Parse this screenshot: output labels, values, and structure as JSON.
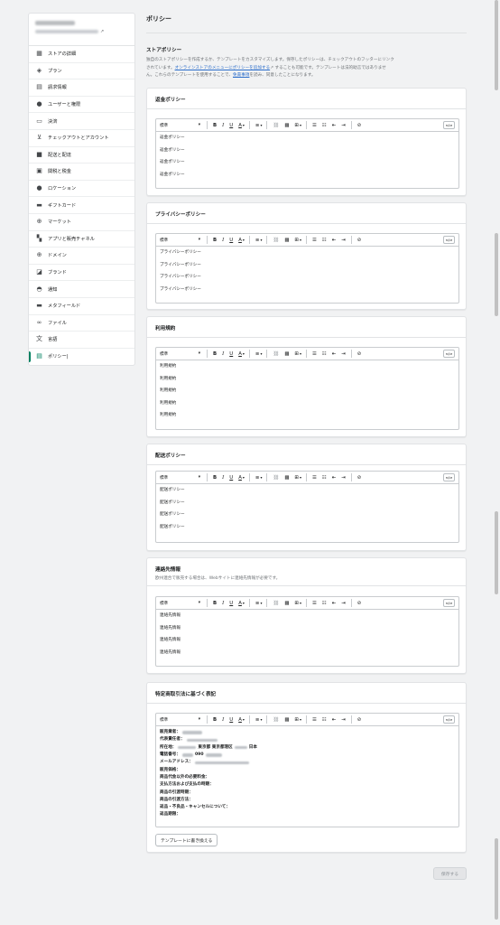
{
  "sidebar": {
    "items": [
      {
        "icon": "store-icon",
        "glyph": "▦",
        "label": "ストアの詳細"
      },
      {
        "icon": "plan-icon",
        "glyph": "◈",
        "label": "プラン"
      },
      {
        "icon": "billing-icon",
        "glyph": "▤",
        "label": "請求情報"
      },
      {
        "icon": "user-icon",
        "glyph": "●",
        "label": "ユーザーと権限"
      },
      {
        "icon": "payment-icon",
        "glyph": "▭",
        "label": "決済"
      },
      {
        "icon": "cart-icon",
        "glyph": "⊻",
        "label": "チェックアウトとアカウント"
      },
      {
        "icon": "truck-icon",
        "glyph": "■",
        "label": "配送と配達"
      },
      {
        "icon": "tax-icon",
        "glyph": "▣",
        "label": "関税と税金"
      },
      {
        "icon": "location-icon",
        "glyph": "●",
        "label": "ロケーション"
      },
      {
        "icon": "gift-card-icon",
        "glyph": "▬",
        "label": "ギフトカード"
      },
      {
        "icon": "globe-icon",
        "glyph": "⊕",
        "label": "マーケット"
      },
      {
        "icon": "apps-icon",
        "glyph": "▚",
        "label": "アプリと販売チャネル"
      },
      {
        "icon": "domain-icon",
        "glyph": "⊕",
        "label": "ドメイン"
      },
      {
        "icon": "brand-icon",
        "glyph": "◪",
        "label": "ブランド"
      },
      {
        "icon": "bell-icon",
        "glyph": "◓",
        "label": "通知"
      },
      {
        "icon": "metafield-icon",
        "glyph": "▬",
        "label": "メタフィールド"
      },
      {
        "icon": "file-icon",
        "glyph": "∞",
        "label": "ファイル"
      },
      {
        "icon": "language-icon",
        "glyph": "文",
        "label": "言語"
      },
      {
        "icon": "policy-icon",
        "glyph": "▤",
        "label": "ポリシー|",
        "active": true
      }
    ]
  },
  "page": {
    "title": "ポリシー"
  },
  "intro": {
    "title": "ストアポリシー",
    "text_1": "独自のストアポリシーを作成するか、テンプレートをカスタマイズします。保存したポリシーは、チェックアウトのフッターにリンク",
    "text_2a": "されています。",
    "link_1": "オンラインストアのメニューにポリシーを追加する",
    "ext_glyph": "↗",
    "text_2b": "することも可能です。テンプレートは法的助言ではありませ",
    "text_3a": "ん。これらのテンプレートを使用することで、",
    "link_2": "免責事項",
    "text_3b": "を読み、同意したことになります。"
  },
  "toolbar": {
    "format": "標準",
    "caret": "▾",
    "bold": "B",
    "italic": "I",
    "underline": "U",
    "color": "A",
    "align": "≡",
    "link": "⛓",
    "image": "▦",
    "table": "⊞",
    "bullet": "☰",
    "number": "☷",
    "outdent": "⇤",
    "indent": "⇥",
    "clear": "⊘",
    "html": "</>"
  },
  "cards": {
    "refund": {
      "title": "返金ポリシー",
      "lines": [
        "返金ポリシー",
        "返金ポリシー",
        "返金ポリシー",
        "返金ポリシー"
      ]
    },
    "privacy": {
      "title": "プライバシーポリシー",
      "lines": [
        "プライバシーポリシー",
        "プライバシーポリシー",
        "プライバシーポリシー",
        "プライバシーポリシー"
      ]
    },
    "terms": {
      "title": "利用規約",
      "lines": [
        "利用規約",
        "利用規約",
        "利用規約",
        "利用規約",
        "利用規約"
      ]
    },
    "shipping": {
      "title": "配送ポリシー",
      "lines": [
        "配送ポリシー",
        "配送ポリシー",
        "配送ポリシー",
        "配送ポリシー"
      ]
    },
    "contact": {
      "title": "連絡先情報",
      "description": "欧州連合で販売する場合は、Webサイトに連絡先情報が必要です。",
      "lines": [
        "連絡先情報",
        "連絡先情報",
        "連絡先情報",
        "連絡先情報"
      ]
    },
    "tokusho": {
      "title": "特定商取引法に基づく表記",
      "lines": [
        {
          "label": "販売業者：",
          "value": ""
        },
        {
          "label": "代表責任者：",
          "value": ""
        },
        {
          "label": "所在地：",
          "value": "東京都 東京都港区",
          "suffix": "日本"
        },
        {
          "label": "電話番号：",
          "value": "090"
        },
        {
          "label": "メールアドレス：",
          "value": ""
        },
        {
          "label": "販売価格：",
          "value": ""
        },
        {
          "label": "商品代金以外の必要料金：",
          "value": ""
        },
        {
          "label": "支払方法および支払の時期：",
          "value": ""
        },
        {
          "label": "商品の引渡時期：",
          "value": ""
        },
        {
          "label": "商品の引渡方法：",
          "value": ""
        },
        {
          "label": "返品・不良品・キャンセルについて：",
          "value": ""
        },
        {
          "label": "返品期限：",
          "value": ""
        }
      ],
      "template_button": "テンプレートに書き換える"
    }
  },
  "footer": {
    "save_label": "保存する"
  }
}
